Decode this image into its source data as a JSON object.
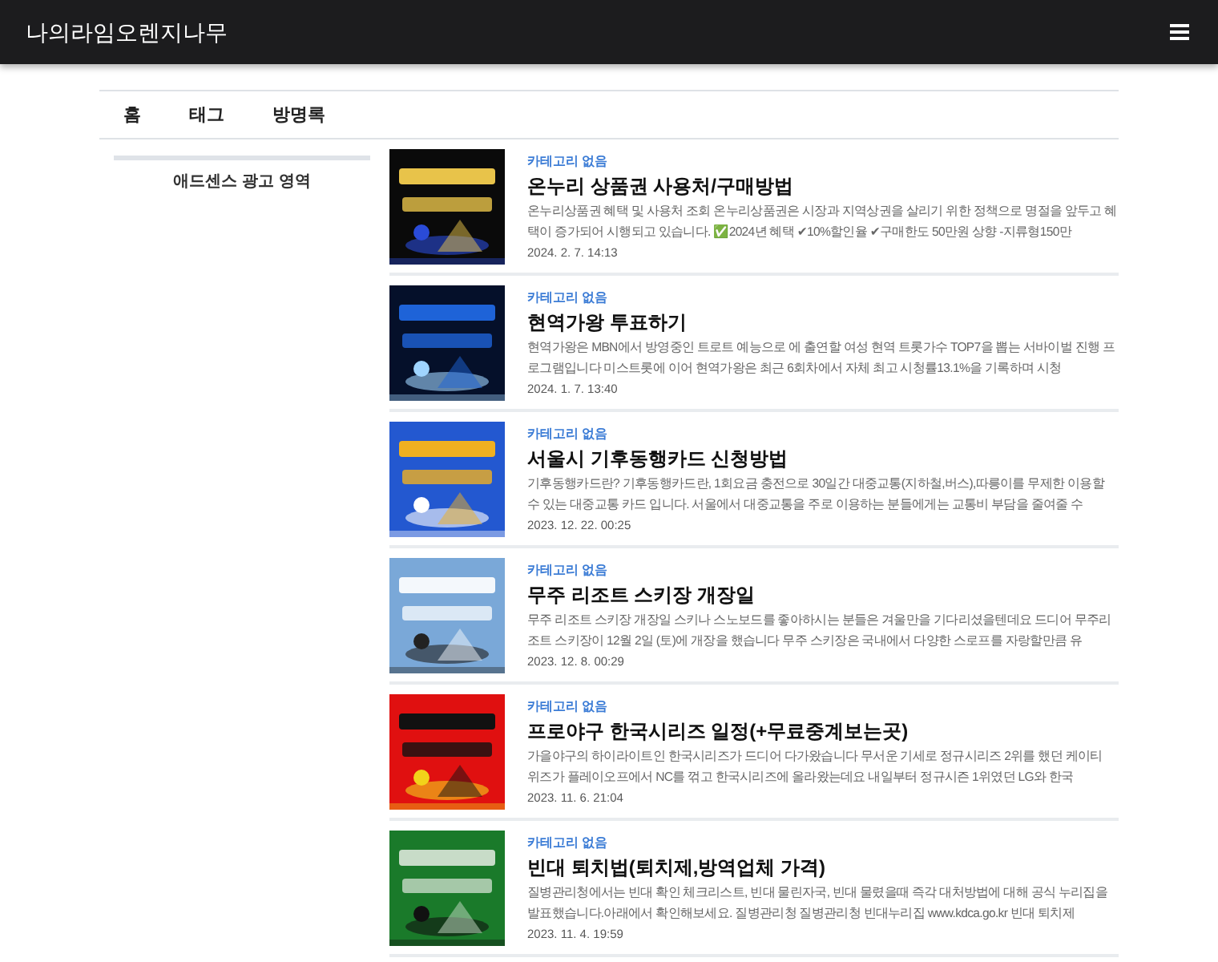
{
  "navbar": {
    "title": "나의라임오렌지나무"
  },
  "tabs": [
    {
      "label": "홈"
    },
    {
      "label": "태그"
    },
    {
      "label": "방명록"
    }
  ],
  "sidebar": {
    "ad_label": "애드센스 광고 영역"
  },
  "posts": [
    {
      "category": "카테고리 없음",
      "title": "온누리 상품권 사용처/구매방법",
      "summary": "온누리상품권 혜택 및 사용처 조회 온누리상품권은 시장과 지역상권을 살리기 위한 정책으로 명절을 앞두고 혜택이 증가되어 시행되고 있습니다. ✅2024년 혜택 ✔10%할인율 ✔구매한도 50만원 상향 -지류형150만",
      "date": "2024. 2. 7. 14:13"
    },
    {
      "category": "카테고리 없음",
      "title": "현역가왕 투표하기",
      "summary": "현역가왕은 MBN에서 방영중인 트로트 예능으로 에 출연할 여성 현역 트롯가수 TOP7을 뽑는 서바이벌 진행 프로그램입니다 미스트롯에 이어 현역가왕은 최근 6회차에서 자체 최고 시청률13.1%을 기록하며 시청",
      "date": "2024. 1. 7. 13:40"
    },
    {
      "category": "카테고리 없음",
      "title": "서울시 기후동행카드 신청방법",
      "summary": "기후동행카드란? 기후동행카드란, 1회요금 충전으로 30일간 대중교통(지하철,버스),따릉이를 무제한 이용할 수 있는 대중교통 카드 입니다. 서울에서 대중교통을 주로 이용하는 분들에게는 교통비 부담을 줄여줄 수",
      "date": "2023. 12. 22. 00:25"
    },
    {
      "category": "카테고리 없음",
      "title": "무주 리조트 스키장 개장일",
      "summary": "무주 리조트 스키장 개장일 스키나 스노보드를 좋아하시는 분들은 겨울만을 기다리셨을텐데요 드디어 무주리조트 스키장이 12월 2일 (토)에 개장을 했습니다 무주 스키장은 국내에서 다양한 스로프를 자랑할만큼 유",
      "date": "2023. 12. 8. 00:29"
    },
    {
      "category": "카테고리 없음",
      "title": "프로야구 한국시리즈 일정(+무료중계보는곳)",
      "summary": "가을야구의 하이라이트인 한국시리즈가 드디어 다가왔습니다 무서운 기세로 정규시리즈 2위를 했던 케이티 위즈가 플레이오프에서 NC를 꺾고 한국시리즈에 올라왔는데요 내일부터 정규시즌 1위였던 LG와 한국",
      "date": "2023. 11. 6. 21:04"
    },
    {
      "category": "카테고리 없음",
      "title": "빈대 퇴치법(퇴치제,방역업체 가격)",
      "summary": "질병관리청에서는 빈대 확인 체크리스트, 빈대 물린자국, 빈대 물렸을때 즉각 대처방법에 대해 공식 누리집을 발표했습니다.아래에서 확인해보세요. 질병관리청 질병관리청 빈대누리집 www.kdca.go.kr 빈대 퇴치제",
      "date": "2023. 11. 4. 19:59"
    }
  ]
}
